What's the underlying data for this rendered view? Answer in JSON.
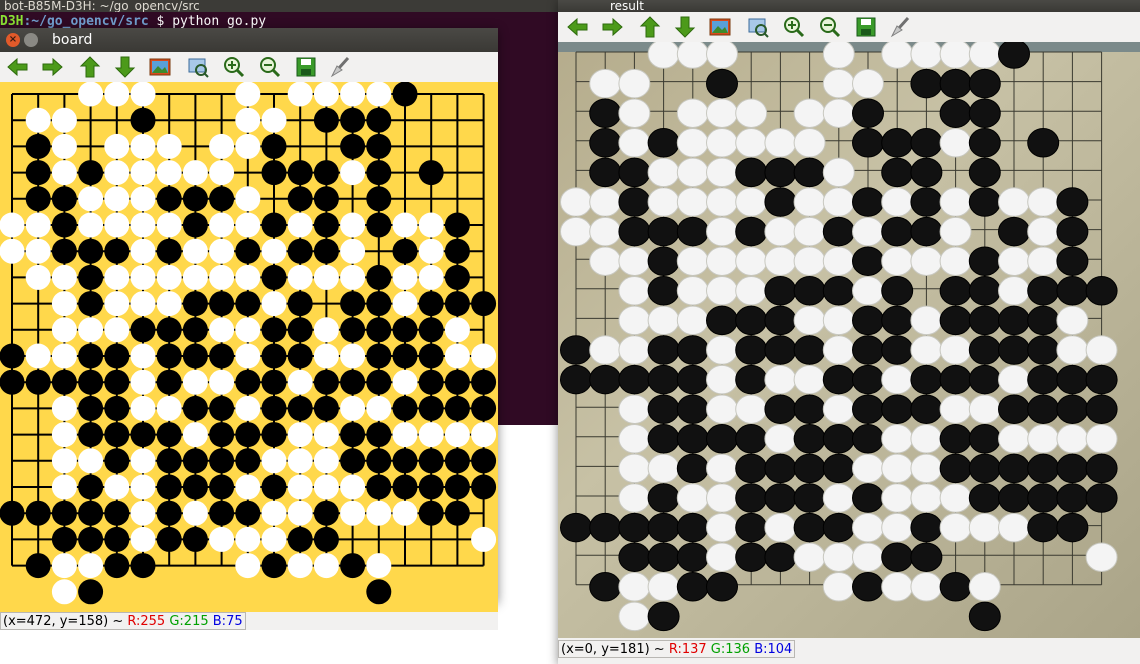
{
  "terminal": {
    "title": "bot-B85M-D3H: ~/go_opencv/src",
    "prompt_user": "D3H",
    "prompt_path": ":~/go_opencv/src",
    "command": "$ python go.py"
  },
  "board_window": {
    "title": "board",
    "close_glyph": "×",
    "status": {
      "coord": "(x=472, y=158) ~ ",
      "r": "R:255",
      "g": "G:215",
      "b": "B:75"
    },
    "colors": {
      "board": "#ffd84b",
      "line": "#000000",
      "black": "#000000",
      "white": "#ffffff"
    }
  },
  "result_window": {
    "title": "result",
    "status": {
      "coord": "(x=0, y=181) ~ ",
      "r": "R:137",
      "g": "G:136",
      "b": "B:104"
    }
  },
  "toolbar_icons": [
    "arrow-left-icon",
    "arrow-right-icon",
    "arrow-up-icon",
    "arrow-down-icon",
    "image-icon",
    "zoom-fit-icon",
    "zoom-in-icon",
    "zoom-out-icon",
    "save-icon",
    "properties-icon"
  ],
  "board": {
    "size": 19,
    "rows": [
      "...WWW...W.WWWWB...",
      ".WW..B...WW.BBB....",
      ".BW.WWW.WWB..BB....",
      ".BWBWWWWW.BBBWB.B..",
      ".BBWWWBBBW.BB.B....",
      "WWBWWWWBWWBWBWBWWB.",
      "WWBBBWBWWBWBBW.BWB.",
      ".WWBWWWWWWBWWWBWWB.",
      "..WBWWWBBBWB.BBWBBB",
      "..WWWBBBWWBBWBBBBW.",
      "BWWBBWBBBWBBWWBBBWW",
      "BBBBBWBWWBBWBBBWBBB",
      "..WBBWWBBWBBBWWBBBB",
      "..WBBBBWBBBWWBBWWWW",
      "..WWBWBBBBWWWBBBBBB",
      "..WBWWBBBWBWWWBBBBB",
      "BBBBBWBWBBWWBWWWBB.",
      "..BBBWBBWWWBB.....W",
      ".BWWBB...WBWWBW....",
      "..WB..........B...."
    ]
  }
}
